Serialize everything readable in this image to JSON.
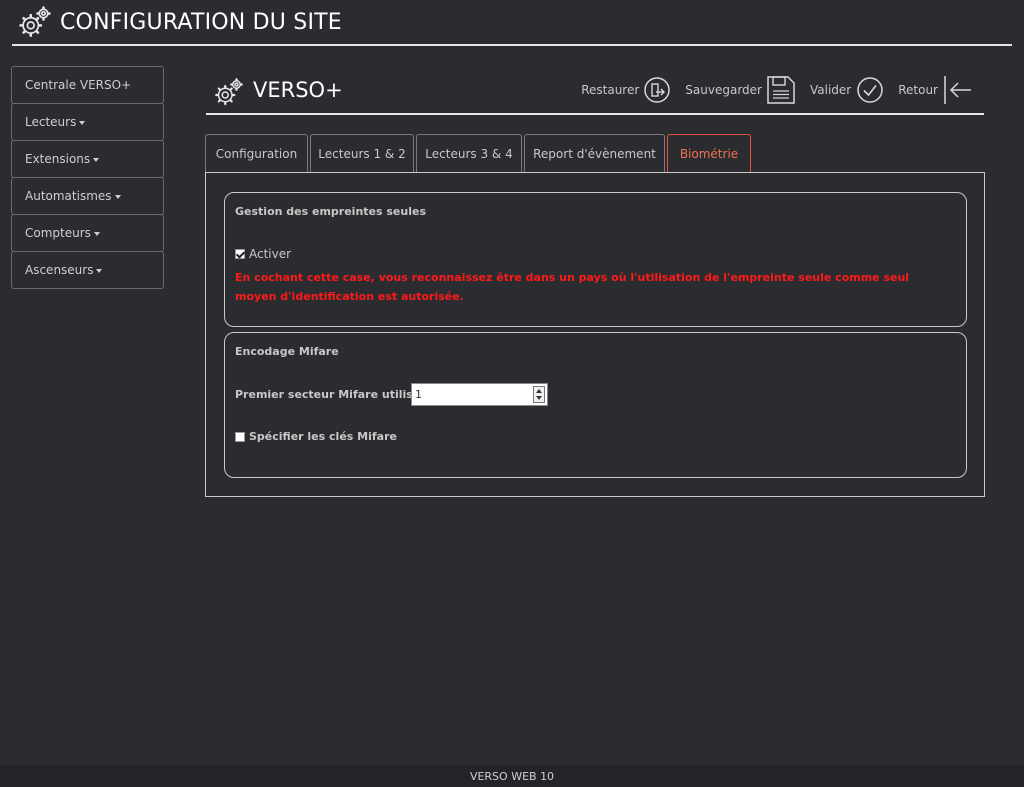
{
  "header": {
    "title": "CONFIGURATION DU SITE"
  },
  "sidebar": {
    "items": [
      {
        "label": "Centrale VERSO+"
      },
      {
        "label": "Lecteurs"
      },
      {
        "label": "Extensions"
      },
      {
        "label": "Automatismes"
      },
      {
        "label": "Compteurs"
      },
      {
        "label": "Ascenseurs"
      }
    ]
  },
  "content": {
    "title": "VERSO+",
    "toolbar": {
      "restore": "Restaurer",
      "save": "Sauvegarder",
      "validate": "Valider",
      "back": "Retour"
    }
  },
  "tabs": [
    {
      "label": "Configuration"
    },
    {
      "label": "Lecteurs 1 & 2"
    },
    {
      "label": "Lecteurs 3 & 4"
    },
    {
      "label": "Report d'évènement"
    },
    {
      "label": "Biométrie",
      "active": true
    }
  ],
  "biometrie": {
    "fingerprint": {
      "title": "Gestion des empreintes seules",
      "activate_label": "Activer",
      "activate_checked": true,
      "warning": "En cochant cette case, vous reconnaissez être dans un pays où l'utilisation de l'empreinte seule comme seul moyen d'identification est autorisée."
    },
    "mifare": {
      "title": "Encodage Mifare",
      "first_sector_label": "Premier secteur Mifare utilisé :",
      "first_sector_value": "1",
      "keys_label": "Spécifier les clés Mifare",
      "keys_checked": false
    }
  },
  "footer": {
    "text": "VERSO WEB 10"
  },
  "colors": {
    "background": "#2b2c30",
    "accent": "#e2553c",
    "warning": "#ff1a1a"
  }
}
